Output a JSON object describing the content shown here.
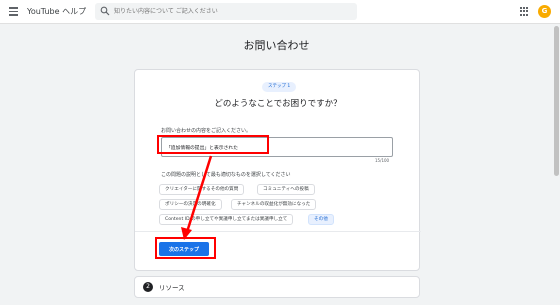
{
  "header": {
    "app_title": "YouTube ヘルプ",
    "search_placeholder": "知りたい内容について ご記入ください",
    "avatar_letter": "G"
  },
  "page": {
    "title": "お問い合わせ"
  },
  "form": {
    "step_badge": "ステップ 1",
    "heading": "どのようなことでお困りですか？",
    "field_label": "お問い合わせの内容をご記入ください。",
    "field_value": "「追加情報の提出」と表示された",
    "char_count": "15/100",
    "chips_label": "この問題の説明として最も適切なものを選択してください",
    "chips": [
      {
        "label": "クリエイターに関するその他の質問",
        "selected": false
      },
      {
        "label": "コミュニティへの投稿",
        "selected": false
      },
      {
        "label": "ポリシーの決定の明確化",
        "selected": false
      },
      {
        "label": "チャンネルの収益化が無効になった",
        "selected": false
      },
      {
        "label": "Content ID の申し立てや異議申し立てまたは異議申し立て",
        "selected": false
      },
      {
        "label": "その他",
        "selected": true
      }
    ],
    "next_button": "次のステップ"
  },
  "resources": {
    "number": "2",
    "label": "リソース"
  },
  "colors": {
    "accent": "#1a73e8",
    "annotation": "#ff0000"
  }
}
